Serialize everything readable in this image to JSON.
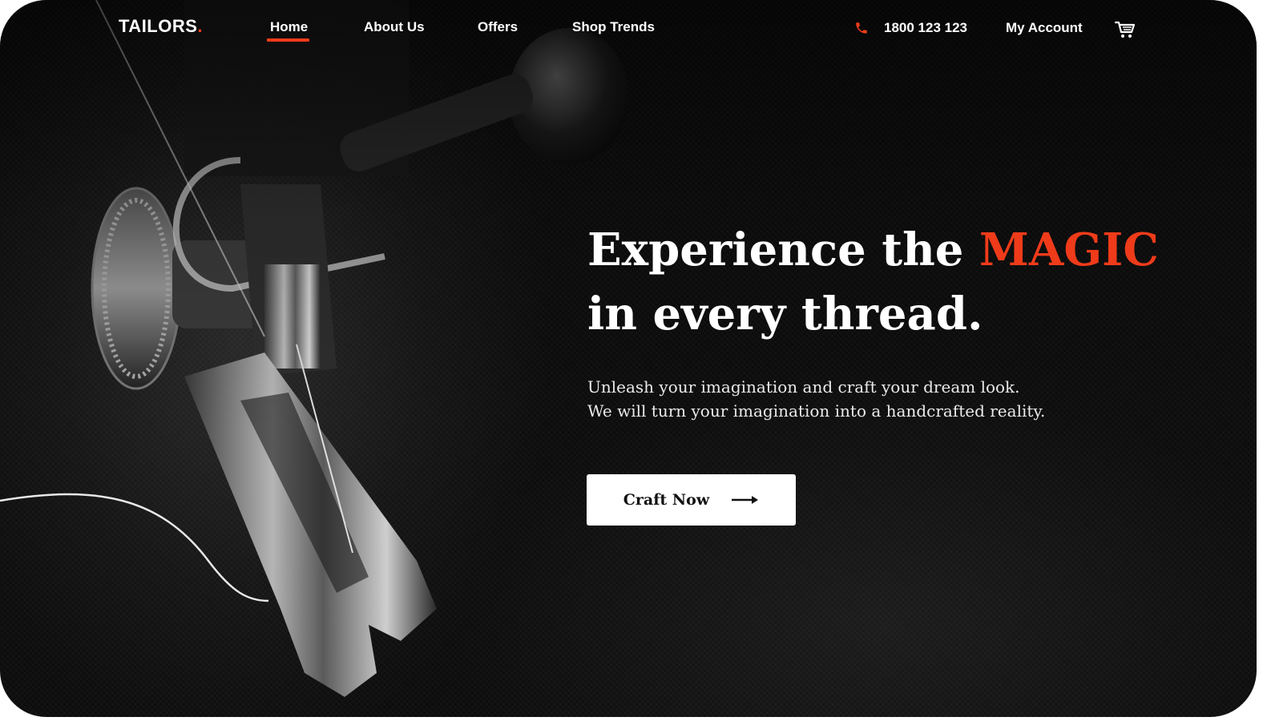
{
  "brand": {
    "name": "TAILORS",
    "dot": ".",
    "accent_color": "#ef3b1a"
  },
  "nav": {
    "items": [
      {
        "label": "Home",
        "active": true
      },
      {
        "label": "About Us",
        "active": false
      },
      {
        "label": "Offers",
        "active": false
      },
      {
        "label": "Shop Trends",
        "active": false
      }
    ],
    "phone": {
      "icon": "phone-icon",
      "number": "1800 123 123"
    },
    "account_label": "My Account",
    "cart": {
      "icon": "cart-icon"
    }
  },
  "hero": {
    "title_part1": "Experience the ",
    "title_highlight": "MAGIC",
    "title_line2": "in every thread.",
    "subtitle_line1": "Unleash your imagination and craft your dream look.",
    "subtitle_line2": "We will turn your imagination into a handcrafted reality.",
    "cta_label": "Craft Now",
    "cta_icon": "arrow-right-icon"
  },
  "background": {
    "subject": "sewing-machine-photo"
  }
}
